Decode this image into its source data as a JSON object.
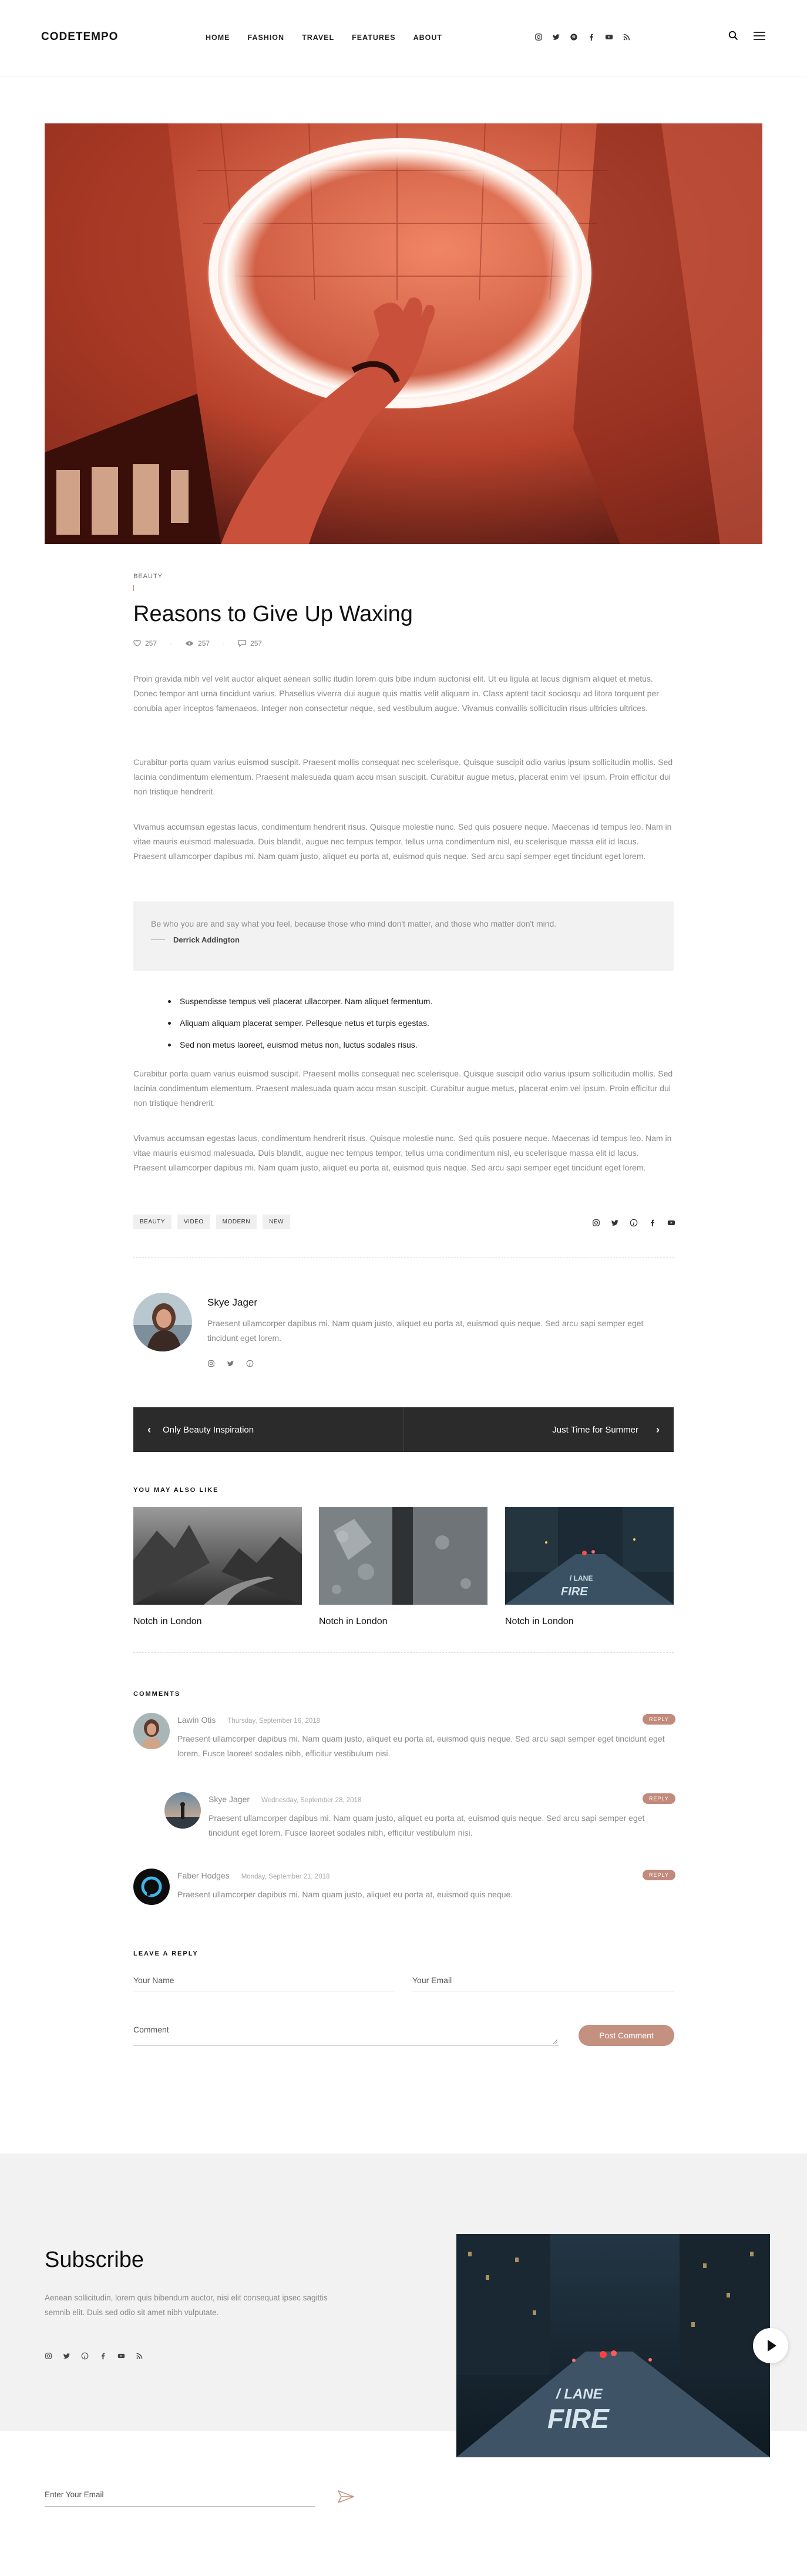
{
  "header": {
    "logo": "CODETEMPO",
    "nav": [
      "HOME",
      "FASHION",
      "TRAVEL",
      "FEATURES",
      "ABOUT"
    ],
    "social_icons": [
      "instagram-icon",
      "twitter-icon",
      "pinterest-icon",
      "facebook-icon",
      "youtube-icon",
      "rss-icon"
    ]
  },
  "article": {
    "category": "BEAUTY",
    "title": "Reasons to Give Up Waxing",
    "likes": "257",
    "views": "257",
    "comments": "257",
    "paragraphs": [
      "Proin gravida nibh vel velit auctor aliquet aenean sollic itudin lorem quis bibe indum auctonisi elit. Ut eu ligula at lacus dignism aliquet et metus. Donec tempor ant urna tincidunt varius. Phasellus viverra dui augue quis mattis velit aliquam in. Class aptent tacit sociosqu ad litora torquent per conubia aper inceptos famenaeos. Integer non consectetur neque, sed vestibulum augue. Vivamus convallis sollicitudin risus ultricies ultrices.",
      "Curabitur porta quam varius euismod suscipit. Praesent mollis consequat nec scelerisque. Quisque suscipit odio varius ipsum sollicitudin mollis. Sed lacinia condimentum elementum. Praesent malesuada quam accu msan suscipit. Curabitur augue metus, placerat enim vel ipsum. Proin efficitur dui non tristique hendrerit.",
      "Vivamus accumsan egestas lacus, condimentum hendrerit risus. Quisque molestie nunc. Sed quis posuere neque. Maecenas id tempus leo. Nam in vitae mauris euismod malesuada. Duis blandit, augue nec tempus tempor, tellus urna condimentum nisl, eu scelerisque massa elit id lacus. Praesent ullamcorper dapibus mi. Nam quam justo, aliquet eu porta at, euismod quis neque. Sed arcu sapi semper eget tincidunt eget lorem.",
      "Curabitur porta quam varius euismod suscipit. Praesent mollis consequat nec scelerisque. Quisque suscipit odio varius ipsum sollicitudin mollis. Sed lacinia condimentum elementum. Praesent malesuada quam accu msan suscipit. Curabitur augue metus, placerat enim vel ipsum. Proin efficitur dui non tristique hendrerit.",
      "Vivamus accumsan egestas lacus, condimentum hendrerit risus. Quisque molestie nunc. Sed quis posuere neque. Maecenas id tempus leo. Nam in vitae mauris euismod malesuada. Duis blandit, augue nec tempus tempor, tellus urna condimentum nisl, eu scelerisque massa elit id lacus. Praesent ullamcorper dapibus mi. Nam quam justo, aliquet eu porta at, euismod quis neque. Sed arcu sapi semper eget tincidunt eget lorem."
    ],
    "quote": {
      "text": "Be who you are and say what you feel, because those who mind don't matter, and those who matter don't mind.",
      "author": "Derrick Addington"
    },
    "bullets": [
      "Suspendisse tempus veli placerat ullacorper. Nam aliquet fermentum.",
      "Aliquam aliquam placerat semper. Pellesque netus et turpis egestas.",
      "Sed non metus laoreet, euismod metus non, luctus sodales risus."
    ],
    "tags": [
      "BEAUTY",
      "VIDEO",
      "MODERN",
      "NEW"
    ]
  },
  "author": {
    "name": "Skye Jager",
    "bio": "Praesent ullamcorper dapibus mi. Nam quam justo, aliquet eu porta at, euismod quis neque. Sed arcu sapi semper eget tincidunt eget lorem."
  },
  "post_nav": {
    "prev": "Only Beauty Inspiration",
    "next": "Just Time for Summer"
  },
  "related": {
    "heading": "YOU MAY ALSO LIKE",
    "items": [
      {
        "caption": "Notch in London"
      },
      {
        "caption": "Notch in London"
      },
      {
        "caption": "Notch in London"
      }
    ]
  },
  "comments": {
    "heading": "COMMENTS",
    "reply_label": "REPLY",
    "items": [
      {
        "name": "Lawin Otis",
        "date": "Thursday, September 16, 2018",
        "text": "Praesent ullamcorper dapibus mi. Nam quam justo, aliquet eu porta at, euismod quis neque. Sed arcu sapi semper eget tincidunt eget lorem. Fusce laoreet sodales nibh, efficitur vestibulum nisi."
      },
      {
        "name": "Skye Jager",
        "date": "Wednesday, September 28, 2018",
        "text": "Praesent ullamcorper dapibus mi. Nam quam justo, aliquet eu porta at, euismod quis neque. Sed arcu sapi semper eget tincidunt eget lorem. Fusce laoreet sodales nibh, efficitur vestibulum nisi."
      },
      {
        "name": "Faber Hodges",
        "date": "Monday, September 21, 2018",
        "text": "Praesent ullamcorper dapibus mi. Nam quam justo, aliquet eu porta at, euismod quis neque."
      }
    ]
  },
  "reply_form": {
    "heading": "LEAVE A REPLY",
    "name_placeholder": "Your Name",
    "email_placeholder": "Your Email",
    "comment_placeholder": "Comment",
    "submit": "Post Comment"
  },
  "subscribe": {
    "title": "Subscribe",
    "text": "Aenean sollicitudin, lorem quis bibendum auctor, nisi elit consequat ipsec sagittis semnib elit. Duis sed odio sit amet nibh vulputate.",
    "email_placeholder": "Enter Your Email",
    "image_text_line1": "/ LANE",
    "image_text_line2": "FIRE"
  },
  "colors": {
    "accent": "#c4907f",
    "dark_bar": "#2b2b2b",
    "muted_text": "#8a8a8a"
  }
}
